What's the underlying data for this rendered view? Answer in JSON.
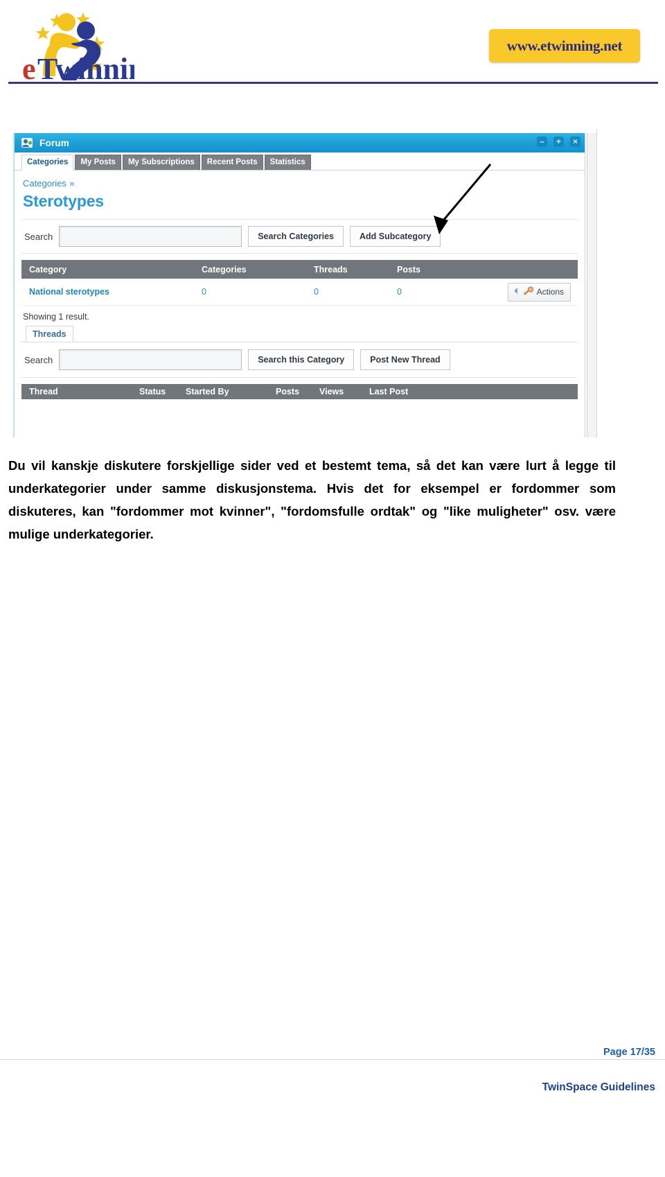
{
  "header": {
    "logo_text": "eTwinning",
    "logo_alt": "etwinning-logo",
    "url_badge": "www.etwinning.net"
  },
  "screenshot": {
    "window": {
      "title": "Forum",
      "icon": "forum-user-icon",
      "controls": {
        "minimize": "–",
        "maximize": "+",
        "close": "×"
      }
    },
    "tabs": [
      {
        "label": "Categories",
        "active": true
      },
      {
        "label": "My Posts",
        "active": false
      },
      {
        "label": "My Subscriptions",
        "active": false
      },
      {
        "label": "Recent Posts",
        "active": false
      },
      {
        "label": "Statistics",
        "active": false
      }
    ],
    "breadcrumb": {
      "label": "Categories",
      "chevron": "»"
    },
    "page_title": "Sterotypes",
    "search_row": {
      "label": "Search",
      "value": "",
      "placeholder": "",
      "buttons": [
        {
          "label": "Search Categories"
        },
        {
          "label": "Add Subcategory"
        }
      ]
    },
    "table": {
      "columns": [
        "Category",
        "Categories",
        "Threads",
        "Posts"
      ],
      "rows": [
        {
          "category": "National sterotypes",
          "categories": "0",
          "threads": "0",
          "posts": "0",
          "action_label": "Actions",
          "action_icon": "wrench-icon"
        }
      ],
      "showing": "Showing 1 result."
    },
    "subtabs": [
      {
        "label": "Threads",
        "active": true
      }
    ],
    "search_row2": {
      "label": "Search",
      "value": "",
      "placeholder": "",
      "buttons": [
        {
          "label": "Search this Category"
        },
        {
          "label": "Post New Thread"
        }
      ]
    },
    "thread_table_columns": [
      "Thread",
      "Status",
      "Started By",
      "Posts",
      "Views",
      "Last Post"
    ]
  },
  "body": {
    "paragraph": "Du vil kanskje diskutere forskjellige sider ved et bestemt tema, så det kan være lurt å legge til underkategorier under samme diskusjonstema. Hvis det for eksempel er fordommer som diskuteres, kan \"fordommer mot kvinner\", \"fordomsfulle ordtak\" og \"like muligheter\" osv. være mulige underkategorier."
  },
  "footer": {
    "page_number": "Page 17/35",
    "doc_title": "TwinSpace Guidelines"
  },
  "colors": {
    "brand_yellow": "#f9c92c",
    "brand_blue": "#2b3990",
    "titlebar_blue": "#1e9fd6",
    "link_blue": "#2b8fc0",
    "table_header_gray": "#70767c"
  }
}
